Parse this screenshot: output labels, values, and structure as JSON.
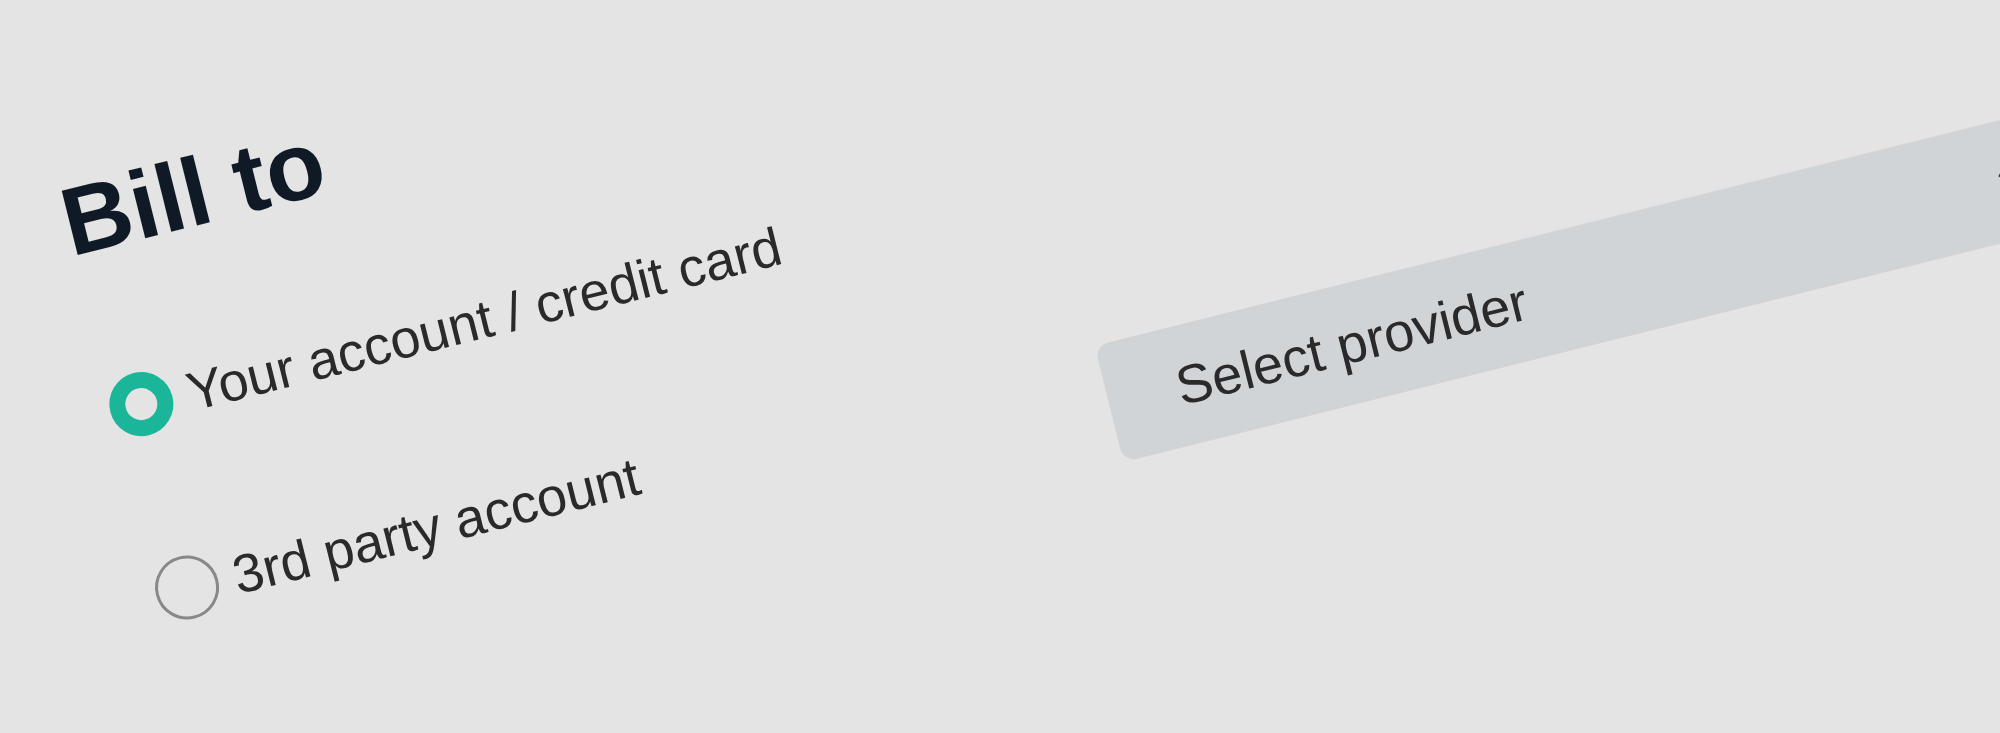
{
  "heading": "Bill to",
  "options": [
    {
      "label": "Your account / credit card",
      "selected": true
    },
    {
      "label": "3rd party account",
      "selected": false
    }
  ],
  "provider_select": {
    "placeholder": "Select provider"
  }
}
